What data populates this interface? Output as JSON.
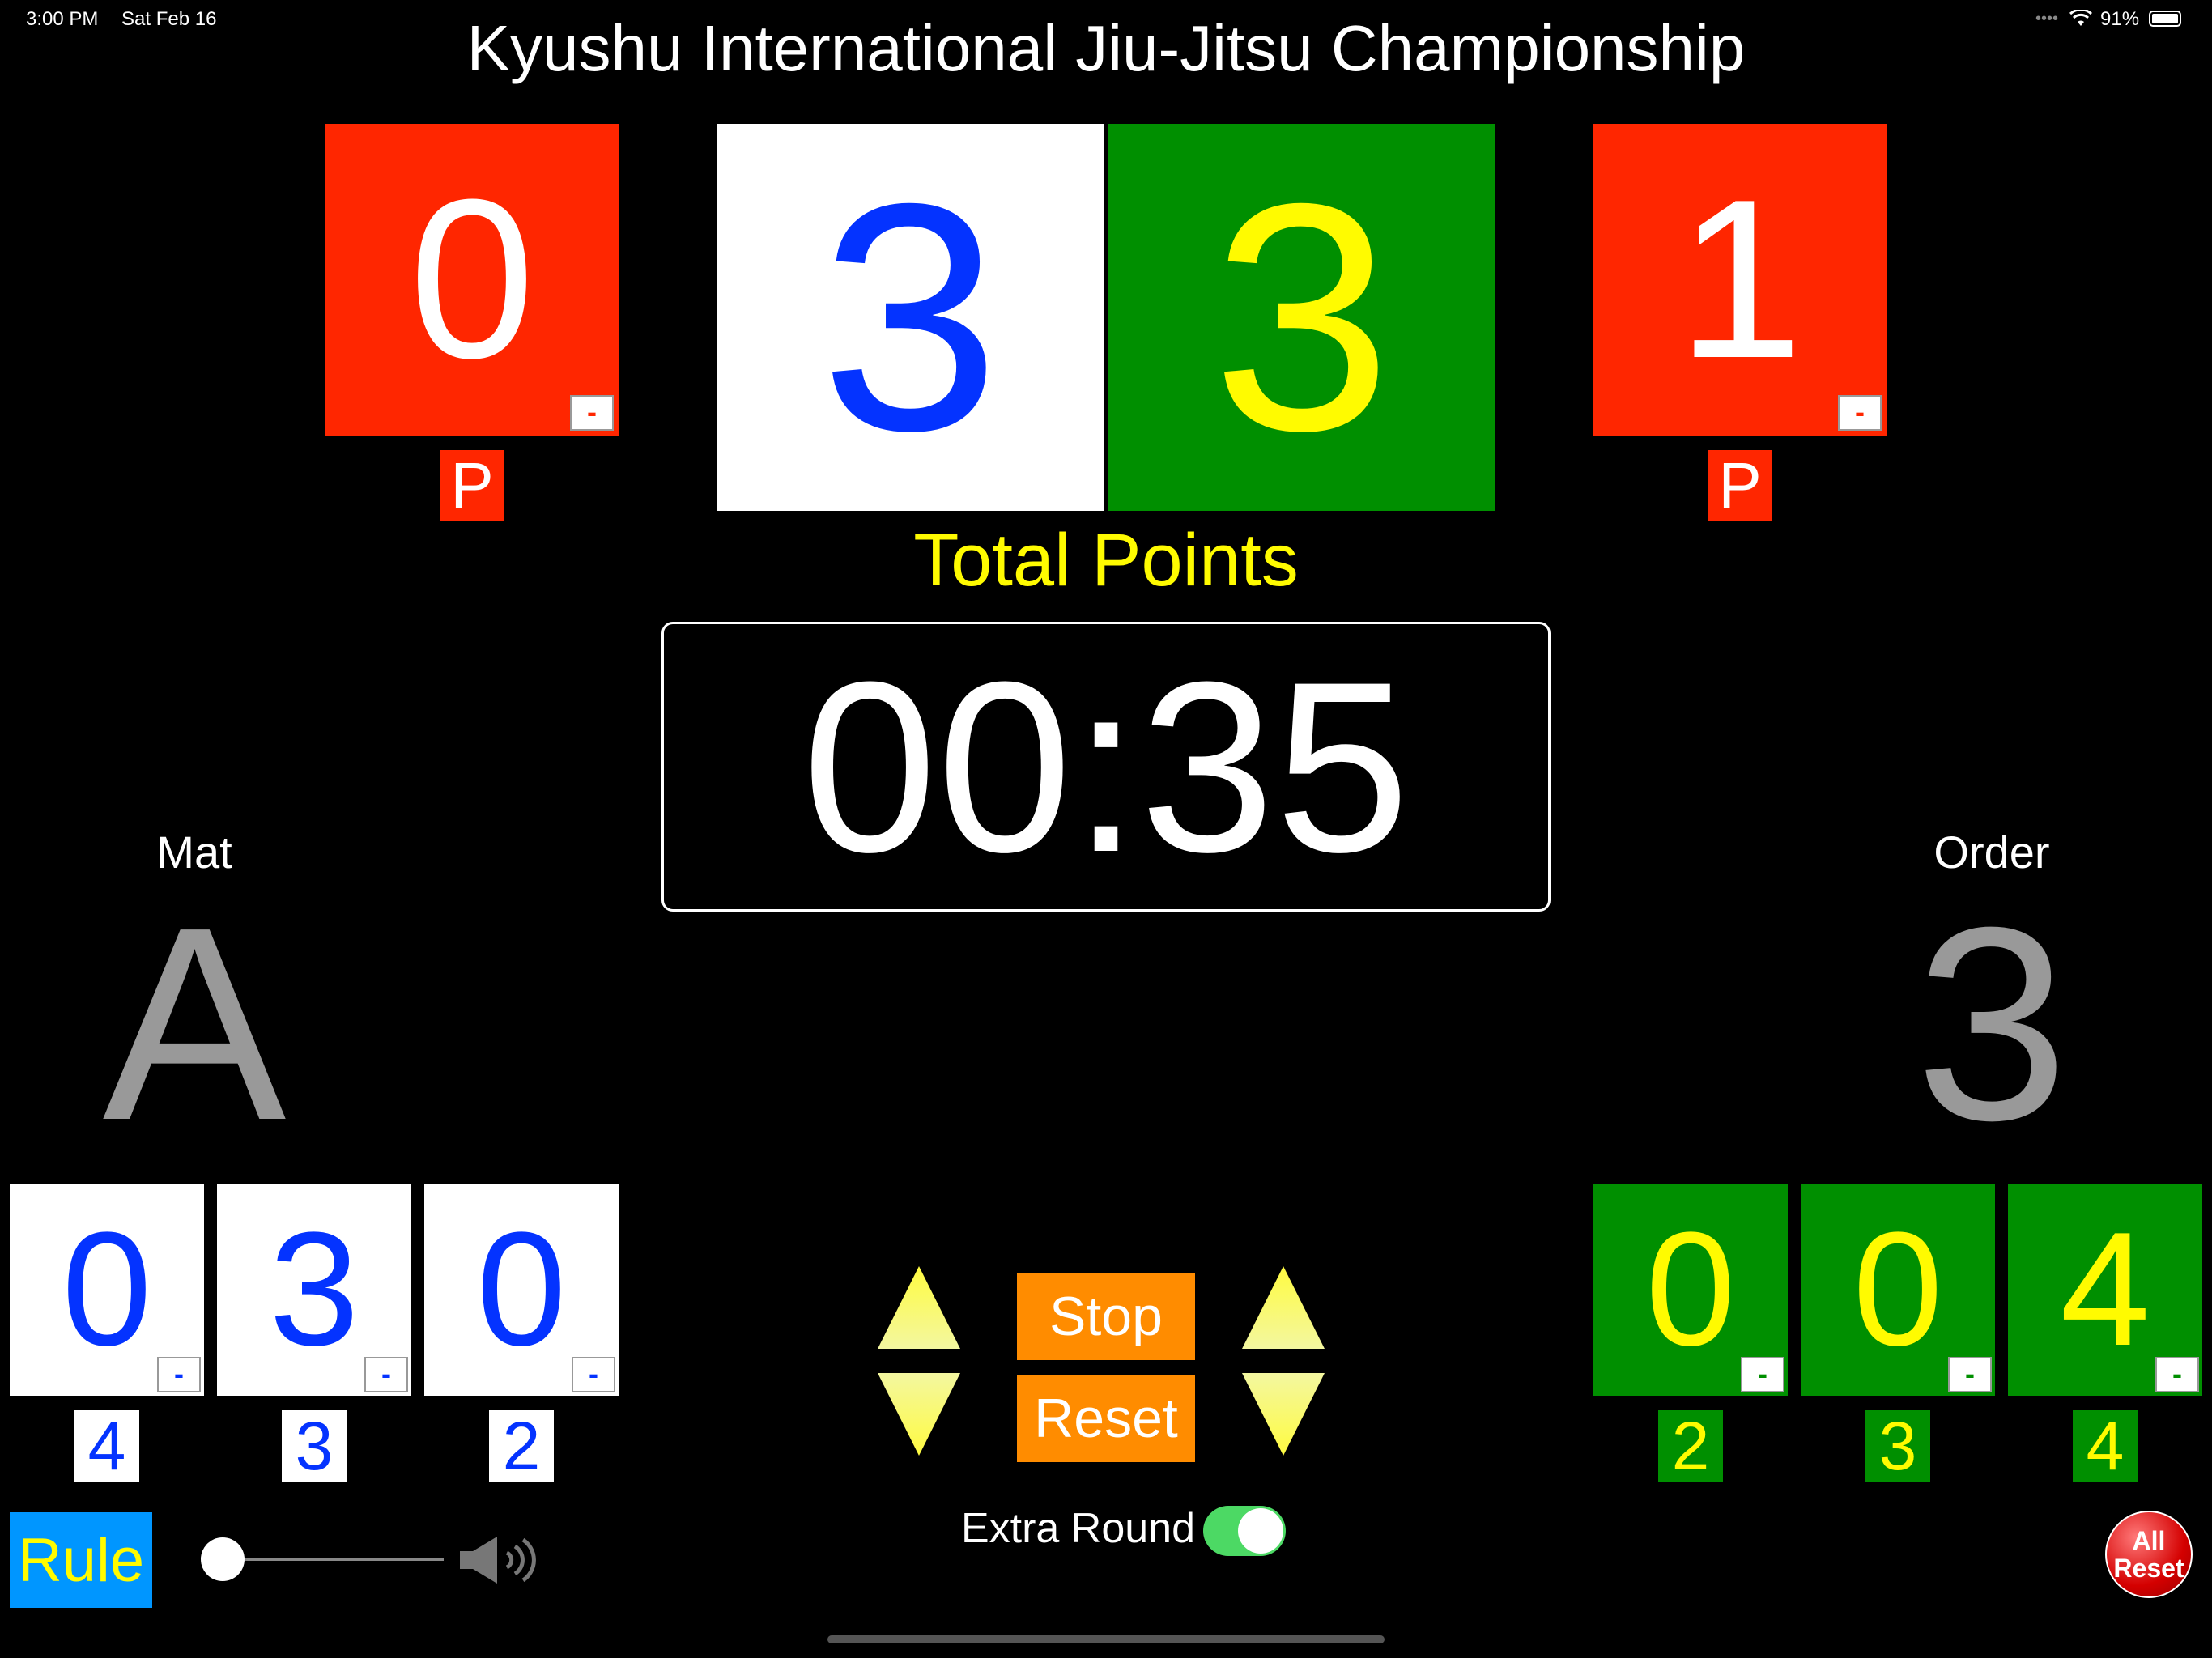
{
  "status_bar": {
    "time": "3:00 PM",
    "date": "Sat Feb 16",
    "battery": "91%"
  },
  "title": "Kyushu International Jiu-Jitsu Championship",
  "left_penalty": {
    "value": "0",
    "minus": "-",
    "badge": "P"
  },
  "right_penalty": {
    "value": "1",
    "minus": "-",
    "badge": "P"
  },
  "score_white": "3",
  "score_green": "3",
  "total_label": "Total Points",
  "timer": "00:35",
  "mat": {
    "label": "Mat",
    "value": "A"
  },
  "order": {
    "label": "Order",
    "value": "3"
  },
  "white_sub": [
    {
      "value": "0",
      "minus": "-",
      "badge": "4"
    },
    {
      "value": "3",
      "minus": "-",
      "badge": "3"
    },
    {
      "value": "0",
      "minus": "-",
      "badge": "2"
    }
  ],
  "green_sub": [
    {
      "value": "0",
      "minus": "-",
      "badge": "2"
    },
    {
      "value": "0",
      "minus": "-",
      "badge": "3"
    },
    {
      "value": "4",
      "minus": "-",
      "badge": "4"
    }
  ],
  "buttons": {
    "stop": "Stop",
    "reset": "Reset",
    "rule": "Rule",
    "all_reset": "All Reset"
  },
  "extra_round": {
    "label": "Extra Round",
    "on": true
  },
  "volume": {
    "level": 0.0
  },
  "colors": {
    "red": "#ff2600",
    "green": "#008f00",
    "blue": "#0433ff",
    "yellow": "#fffb00",
    "orange": "#ff8c00",
    "rule_blue": "#0096ff"
  },
  "icons": {
    "wifi": "wifi-icon",
    "battery": "battery-icon",
    "speaker": "speaker-icon",
    "up": "triangle-up-icon",
    "down": "triangle-down-icon"
  }
}
